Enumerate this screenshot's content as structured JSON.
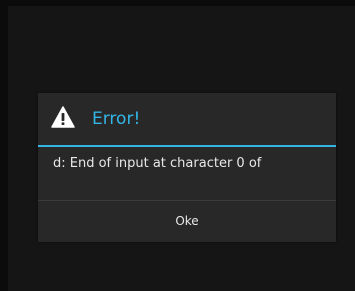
{
  "dialog": {
    "title": "Error!",
    "message": "d: End of input at character 0 of",
    "button_label": "Oke",
    "icon": "warning-icon"
  },
  "colors": {
    "accent": "#33b5e5",
    "dialog_bg": "#282828",
    "screen_bg": "#0b0b0b",
    "text": "#e8e8e8"
  }
}
